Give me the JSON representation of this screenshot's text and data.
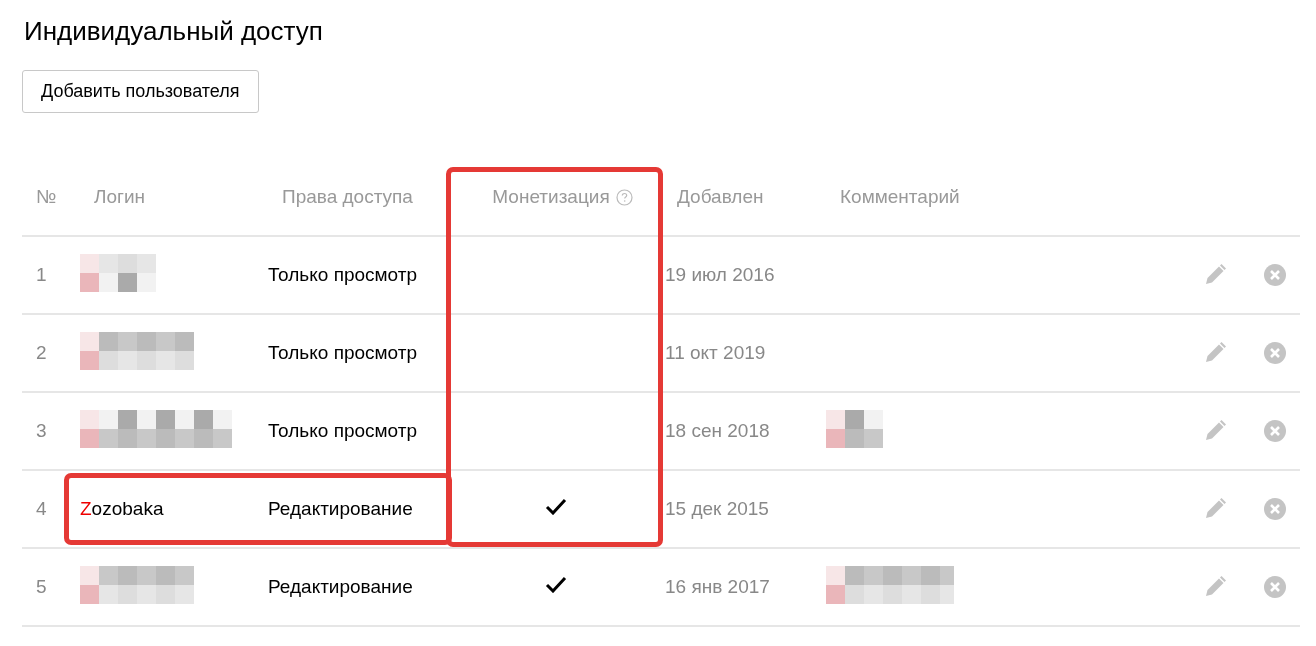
{
  "title": "Индивидуальный доступ",
  "add_button": "Добавить пользователя",
  "columns": [
    {
      "label": "№",
      "highlighted": false,
      "help": false
    },
    {
      "label": "Логин",
      "highlighted": false,
      "help": false
    },
    {
      "label": "Права доступа",
      "highlighted": false,
      "help": false
    },
    {
      "label": "Монетизация",
      "highlighted": true,
      "help": true
    },
    {
      "label": "Добавлен",
      "highlighted": false,
      "help": false
    },
    {
      "label": "Комментарий",
      "highlighted": false,
      "help": false
    }
  ],
  "rows": [
    {
      "number": "1",
      "login_redacted": true,
      "rights": "Только просмотр",
      "monetization": false,
      "added": "19 июл 2016",
      "comment_redacted": false,
      "highlighted": false
    },
    {
      "number": "2",
      "login_redacted": true,
      "rights": "Только просмотр",
      "monetization": false,
      "added": "11 окт 2019",
      "comment_redacted": false,
      "highlighted": false
    },
    {
      "number": "3",
      "login_redacted": true,
      "rights": "Только просмотр",
      "monetization": false,
      "added": "18 сен 2018",
      "comment_redacted": true,
      "highlighted": false
    },
    {
      "number": "4",
      "login": "Zozobaka",
      "login_redacted": false,
      "rights": "Редактирование",
      "monetization": true,
      "added": "15 дек 2015",
      "comment_redacted": false,
      "highlighted": true
    },
    {
      "number": "5",
      "login_redacted": true,
      "rights": "Редактирование",
      "monetization": true,
      "added": "16 янв 2017",
      "comment_redacted": true,
      "highlighted": false
    }
  ]
}
